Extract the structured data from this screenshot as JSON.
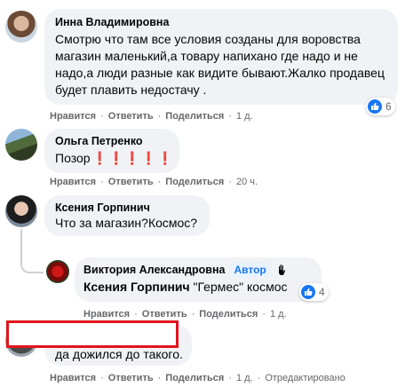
{
  "actions": {
    "like": "Нравится",
    "reply": "Ответить",
    "share": "Поделиться",
    "dot": "·",
    "edited": "Отредактировано"
  },
  "comments": [
    {
      "author": "Инна Владимировна",
      "text": "Смотрю что там все условия созданы для воровства магазин маленький,а товару напихано где надо и не надо,а люди разные как видите бывают.Жалко продавец будет плавить недостачу .",
      "time": "1 д.",
      "reactions": "6"
    },
    {
      "author": "Ольга Петренко",
      "text": "Позор",
      "emoji": "❗❗❗❗❗",
      "time": "20 ч."
    },
    {
      "author": "Ксения Горпинич",
      "text": "Что за магазин?Космос?",
      "time": "1 д."
    },
    {
      "author": "Виктория Александровна",
      "badge": "Автор",
      "mention": "Ксения Горпинич",
      "text": " \"Гермес\" космос",
      "reactions": "4",
      "time": "1 д."
    },
    {
      "text": "да дожился до такого.",
      "time": "1 д."
    }
  ],
  "colors": {
    "bubble": "#f0f2f5",
    "like_blue": "#1877f2",
    "redaction_red": "#e0141e",
    "meta_gray": "#65676b"
  }
}
